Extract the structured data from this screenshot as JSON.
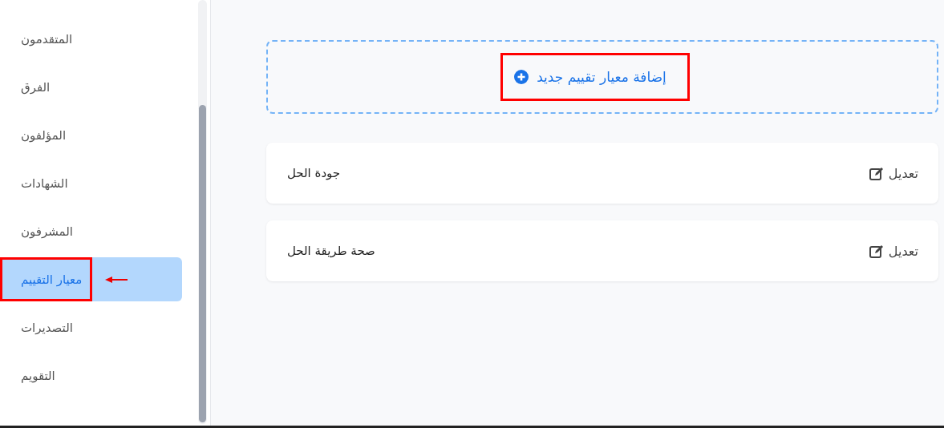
{
  "sidebar": {
    "items": [
      {
        "label": "المتقدمون",
        "selected": false,
        "highlighted": false
      },
      {
        "label": "الفرق",
        "selected": false,
        "highlighted": false
      },
      {
        "label": "المؤلفون",
        "selected": false,
        "highlighted": false
      },
      {
        "label": "الشهادات",
        "selected": false,
        "highlighted": false
      },
      {
        "label": "المشرفون",
        "selected": false,
        "highlighted": false
      },
      {
        "label": "معيار التقييم",
        "selected": true,
        "highlighted": true
      },
      {
        "label": "التصديرات",
        "selected": false,
        "highlighted": false
      },
      {
        "label": "التقويم",
        "selected": false,
        "highlighted": false
      }
    ]
  },
  "add_button": {
    "label": "إضافة معيار تقييم جديد",
    "highlighted": true
  },
  "criteria": [
    {
      "name": "جودة الحل",
      "edit": "تعديل"
    },
    {
      "name": "صحة طريقة الحل",
      "edit": "تعديل"
    }
  ]
}
